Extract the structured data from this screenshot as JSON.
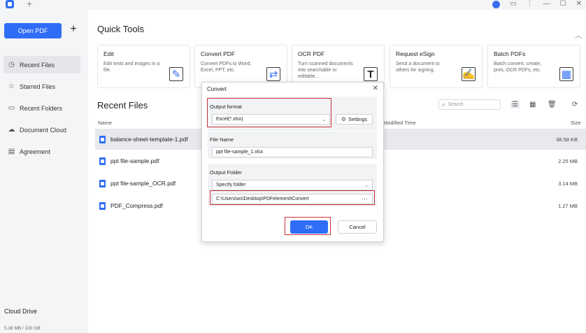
{
  "titlebar": {
    "icons": [
      "app-logo",
      "new-tab-plus-icon",
      "avatar",
      "chat-icon",
      "more-icon",
      "minimize-icon",
      "maximize-icon",
      "close-icon"
    ],
    "new_tab": "+",
    "more": "⋮",
    "minimize": "—",
    "maximize": "☐",
    "close": "✕"
  },
  "sidebar": {
    "open_label": "Open PDF",
    "plus": "+",
    "items": [
      {
        "label": "Recent Files",
        "icon": "clock-icon",
        "active": true
      },
      {
        "label": "Starred Files",
        "icon": "star-icon",
        "active": false
      },
      {
        "label": "Recent Folders",
        "icon": "folder-icon",
        "active": false
      },
      {
        "label": "Document Cloud",
        "icon": "cloud-icon",
        "active": false
      },
      {
        "label": "Agreement",
        "icon": "document-icon",
        "active": false
      }
    ],
    "cloud_title": "Cloud Drive",
    "cloud_usage": "5.38 MB / 100 GB"
  },
  "quick_tools": {
    "title": "Quick Tools",
    "cards": [
      {
        "title": "Edit",
        "desc": "Edit texts and images in a file."
      },
      {
        "title": "Convert PDF",
        "desc": "Convert PDFs to Word, Excel, PPT, etc."
      },
      {
        "title": "OCR PDF",
        "desc": "Turn scanned documents into searchable or editable..."
      },
      {
        "title": "Request eSign",
        "desc": "Send a document to others for signing."
      },
      {
        "title": "Batch PDFs",
        "desc": "Batch convert, create, print, OCR PDFs, etc."
      }
    ]
  },
  "recent_files": {
    "title": "Recent Files",
    "search_placeholder": "Search",
    "columns": {
      "name": "Name",
      "modified": "Modified Time",
      "size": "Size"
    },
    "rows": [
      {
        "name": "balance-sheet-template-1.pdf",
        "size": "38.58 KB"
      },
      {
        "name": "ppt file-sample.pdf",
        "size": "2.25 MB"
      },
      {
        "name": "ppt file-sample_OCR.pdf",
        "size": "3.14 MB"
      },
      {
        "name": "PDF_Compress.pdf",
        "size": "1.27 MB"
      }
    ]
  },
  "dialog": {
    "title": "Convert",
    "close": "✕",
    "output_format_label": "Output format",
    "output_format_value": "Excel(*.xlsx)",
    "settings_label": "Settings",
    "file_name_label": "File Name",
    "file_name_value": "ppt file-sample_1.xlsx",
    "output_folder_label": "Output Folder",
    "folder_option": "Specify folder",
    "folder_path": "C:\\Users\\ws\\Desktop\\PDFelement\\Convert",
    "ellipsis": "···",
    "ok_label": "OK",
    "cancel_label": "Cancel"
  },
  "colors": {
    "accent": "#2f6df6",
    "highlight": "#c8303a"
  }
}
